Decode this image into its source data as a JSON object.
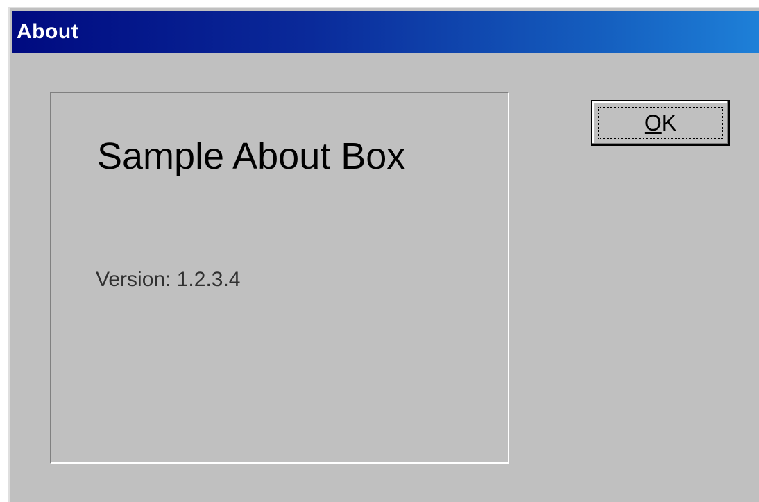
{
  "window": {
    "title": "About"
  },
  "about": {
    "app_name": "Sample About Box",
    "version_text": "Version: 1.2.3.4"
  },
  "buttons": {
    "ok_mnemonic": "O",
    "ok_rest": "K"
  },
  "colors": {
    "titlebar_start": "#000a80",
    "titlebar_end": "#1e80d8",
    "dialog_face": "#c0c0c0"
  }
}
